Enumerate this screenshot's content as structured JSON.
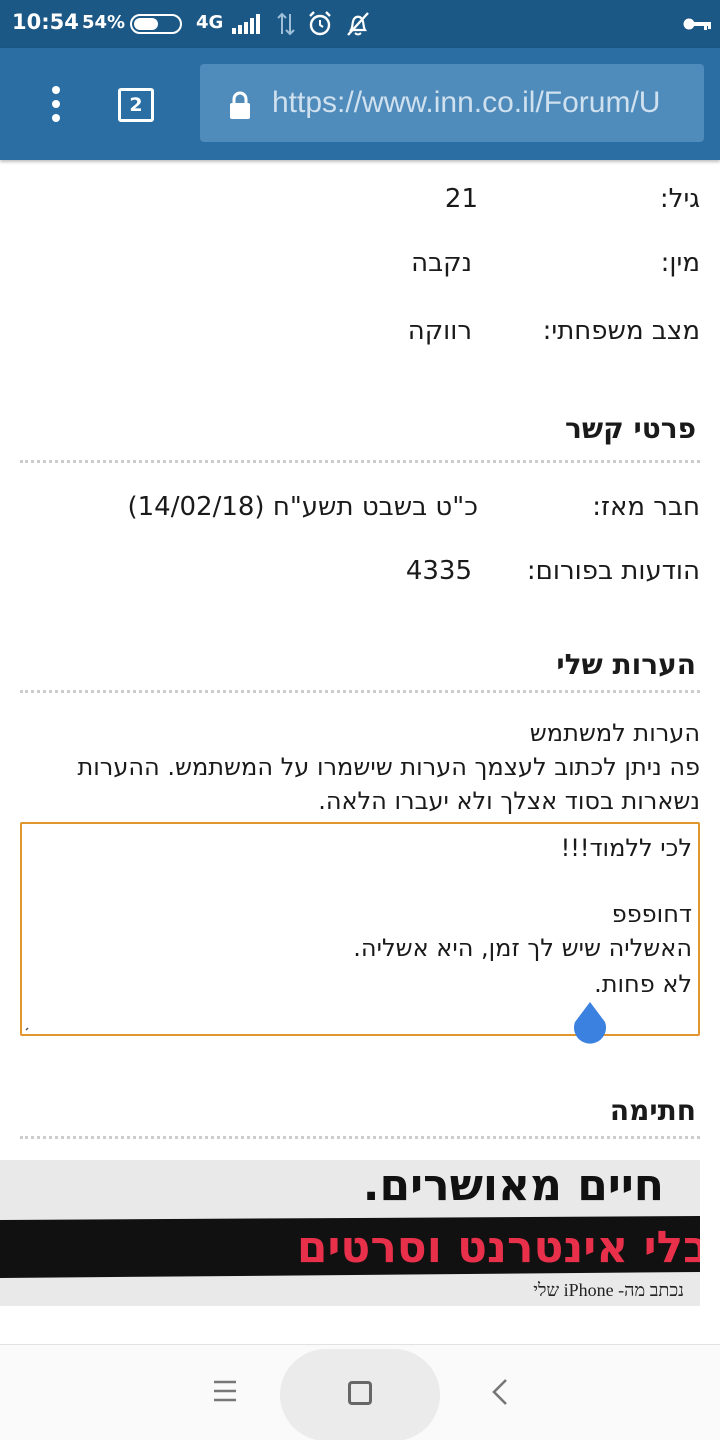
{
  "status_bar": {
    "time": "10:54",
    "battery_percent": "54%",
    "battery_level": 0.54,
    "network": "4G"
  },
  "browser": {
    "tab_count": "2",
    "url": "https://www.inn.co.il/Forum/U"
  },
  "profile": {
    "age_label": "גיל:",
    "age_value": "21",
    "gender_label": "מין:",
    "gender_value": "נקבה",
    "marital_label": "מצב משפחתי:",
    "marital_value": "רווקה"
  },
  "contact": {
    "title": "פרטי קשר",
    "member_since_label": "חבר מאז:",
    "member_since_value": "כ\"ט בשבט תשע\"ח (14/02/18)",
    "posts_label": "הודעות בפורום:",
    "posts_value": "4335"
  },
  "notes": {
    "title": "הערות שלי",
    "subtitle": "הערות למשתמש",
    "description_line1": "פה ניתן לכתוב לעצמך הערות שישמרו על המשתמש. ההערות",
    "description_line2": "נשארות בסוד אצלך ולא יעברו הלאה.",
    "line1": "לכי ללמוד!!!",
    "line2": "דחופפפ",
    "line3": "האשליה שיש לך זמן, היא אשליה.",
    "line4": "לא פחות."
  },
  "signature": {
    "title": "חתימה",
    "image_text_top": "חיים מאושרים.",
    "image_text_band": "בלי אינטרנט וסרטים",
    "image_caption": "נכתב מה- iPhone שלי"
  },
  "colors": {
    "status_bar": "#1b5886",
    "toolbar": "#2a6ea4",
    "url_bar": "#4f8bbb",
    "notes_border": "#e0962c",
    "drop_handle": "#3b82e0"
  },
  "icons": {
    "menu": "vertical-dots-icon",
    "lock": "lock-icon",
    "alarm": "alarm-icon",
    "mute": "bell-off-icon",
    "key": "key-icon",
    "nav_menu": "hamburger-icon",
    "nav_home": "square-icon",
    "nav_back": "chevron-left-icon"
  }
}
